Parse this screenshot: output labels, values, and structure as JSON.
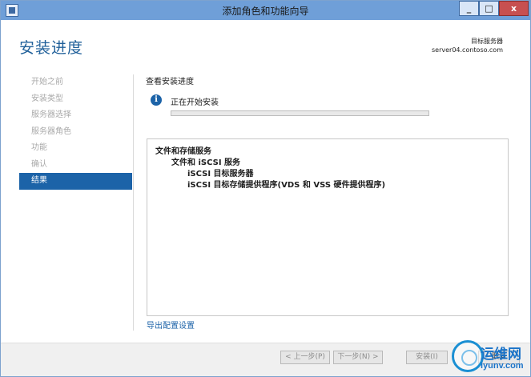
{
  "window": {
    "title": "添加角色和功能向导",
    "controls": {
      "minimize": "_",
      "maximize": "□",
      "close": "x"
    }
  },
  "header": {
    "title": "安装进度",
    "destination_label": "目标服务器",
    "destination_server": "server04.contoso.com"
  },
  "nav": {
    "items": [
      {
        "label": "开始之前",
        "active": false
      },
      {
        "label": "安装类型",
        "active": false
      },
      {
        "label": "服务器选择",
        "active": false
      },
      {
        "label": "服务器角色",
        "active": false
      },
      {
        "label": "功能",
        "active": false
      },
      {
        "label": "确认",
        "active": false
      },
      {
        "label": "结果",
        "active": true
      }
    ]
  },
  "main": {
    "heading": "查看安装进度",
    "status_icon": "info-icon",
    "status_text": "正在开始安装",
    "progress_fraction": 0.0,
    "results": [
      "文件和存储服务",
      "文件和 iSCSI 服务",
      "iSCSI 目标服务器",
      "iSCSI 目标存储提供程序(VDS 和 VSS 硬件提供程序)"
    ],
    "export_link": "导出配置设置"
  },
  "footer": {
    "prev_label": "< 上一步(P)",
    "next_label": "下一步(N) >",
    "install_label": "安装(I)",
    "cancel_label": "取消"
  },
  "watermark": {
    "top": "运维网",
    "bottom": "iyunv.com"
  },
  "colors": {
    "accent": "#1c63a8",
    "titlebar": "#6f9fd8",
    "close": "#c75050"
  }
}
